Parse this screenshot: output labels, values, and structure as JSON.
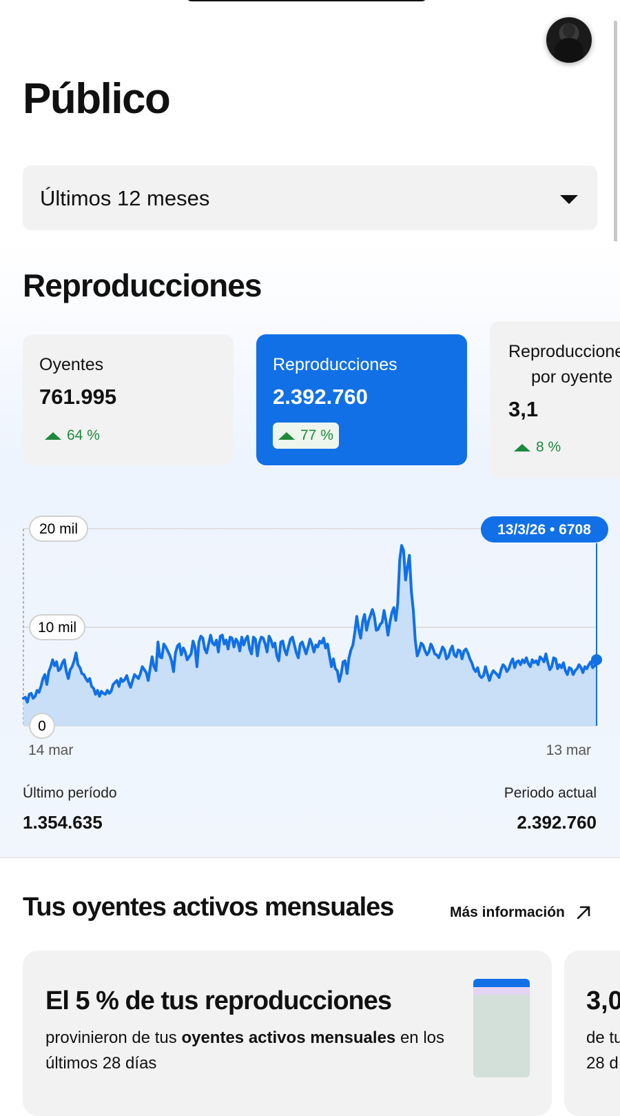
{
  "header": {
    "title": "Público",
    "avatar": "artist-avatar"
  },
  "period_select": {
    "value": "Últimos 12 meses"
  },
  "section": {
    "title": "Reproducciones"
  },
  "cards": [
    {
      "label": "Oyentes",
      "value": "761.995",
      "change": "64 %"
    },
    {
      "label": "Reproducciones",
      "value": "2.392.760",
      "change": "77 %"
    },
    {
      "label_line1": "Reproducciones",
      "label_line2": "por oyente",
      "value": "3,1",
      "change": "8 %"
    }
  ],
  "chart_data": {
    "type": "area",
    "series": [
      {
        "values": [
          2800,
          2900,
          2400,
          3200,
          3300,
          2800,
          3000,
          3600,
          3400,
          4000,
          4800,
          5200,
          4200,
          5500,
          6000,
          6700,
          6100,
          6500,
          5600,
          5800,
          6400,
          6700,
          5500,
          4800,
          5700,
          6000,
          6600,
          7400,
          6200,
          5900,
          5300,
          5200,
          4800,
          4500,
          4800,
          4000,
          3800,
          3200,
          3600,
          3000,
          3500,
          3300,
          3200,
          3600,
          3300,
          3500,
          4200,
          4400,
          4600,
          4000,
          4800,
          4500,
          4700,
          5100,
          4400,
          3900,
          4600,
          5200,
          5000,
          4800,
          5300,
          6000,
          5700,
          5400,
          4600,
          5800,
          7000,
          6000,
          5600,
          8500,
          7000,
          6900,
          8300,
          8000,
          7600,
          7200,
          6600,
          5500,
          7400,
          8100,
          8300,
          7200,
          7900,
          7500,
          6700,
          7000,
          7300,
          8600,
          8000,
          6000,
          8500,
          9100,
          8900,
          7800,
          7400,
          8300,
          9200,
          8400,
          8200,
          8700,
          7500,
          9100,
          9200,
          8300,
          8700,
          7800,
          9000,
          8900,
          8000,
          8800,
          8500,
          7600,
          9000,
          8200,
          8800,
          9100,
          7800,
          7300,
          9000,
          8800,
          7100,
          8400,
          9000,
          8900,
          8300,
          7500,
          9100,
          8700,
          8000,
          8400,
          7100,
          6600,
          8500,
          8600,
          7700,
          7200,
          8100,
          8800,
          9000,
          8200,
          7400,
          6900,
          8300,
          8500,
          7900,
          7300,
          8000,
          8800,
          8300,
          7500,
          8200,
          8000,
          8600,
          8400,
          8900,
          7900,
          8300,
          7100,
          6000,
          6800,
          5800,
          5600,
          4500,
          5300,
          6500,
          6600,
          5300,
          6900,
          7700,
          8200,
          9500,
          11100,
          9800,
          8900,
          10600,
          11300,
          9700,
          10600,
          11200,
          11800,
          11100,
          9700,
          9800,
          10300,
          10500,
          11700,
          10600,
          9200,
          10500,
          11500,
          12000,
          10700,
          12400,
          16800,
          18300,
          17800,
          14800,
          16100,
          17300,
          13600,
          11700,
          8700,
          7100,
          7600,
          8400,
          8200,
          7600,
          7200,
          7500,
          8300,
          7900,
          7300,
          7200,
          6900,
          7400,
          8000,
          7700,
          6800,
          7000,
          7700,
          8100,
          7200,
          7000,
          7700,
          7600,
          6800,
          7600,
          7800,
          7400,
          6800,
          6400,
          5800,
          5500,
          5900,
          5100,
          4900,
          5100,
          6000,
          5300,
          4600,
          5200,
          5600,
          5400,
          5200,
          4900,
          5700,
          6200,
          6000,
          5500,
          5800,
          6400,
          6800,
          5900,
          6500,
          6600,
          6200,
          6700,
          6400,
          6900,
          6300,
          6000,
          6700,
          6400,
          6600,
          6200,
          7000,
          6800,
          6500,
          7300,
          6400,
          5700,
          6000,
          6900,
          6800,
          5800,
          6200,
          5900,
          6400,
          5600,
          5200,
          5900,
          5800,
          5200,
          5600,
          5800,
          6200,
          5900,
          5400,
          6000,
          5800,
          6200,
          6500,
          5900,
          6100,
          6708
        ]
      }
    ],
    "ylim": [
      0,
      20000
    ],
    "y_ticks": [
      "0",
      "10 mil",
      "20 mil"
    ],
    "x_labels": [
      "14 mar",
      "13 mar"
    ],
    "tooltip": "13/3/26 • 6708",
    "grid": true
  },
  "comparison": {
    "last_label": "Último período",
    "last_value": "1.354.635",
    "current_label": "Periodo actual",
    "current_value": "2.392.760"
  },
  "monthly": {
    "title": "Tus oyentes activos mensuales",
    "link": "Más información",
    "card1": {
      "headline": "El 5 % de tus reproducciones",
      "desc_a": "provinieron de tus ",
      "desc_b": "oyentes activos mensuales",
      "desc_c": " en los últimos 28 días"
    },
    "card2": {
      "headline": "3,0",
      "desc": "de tu\n28 d"
    }
  },
  "colors": {
    "accent": "#1170e6",
    "positive": "#1c8a3c",
    "area_fill": "#c9def7"
  }
}
